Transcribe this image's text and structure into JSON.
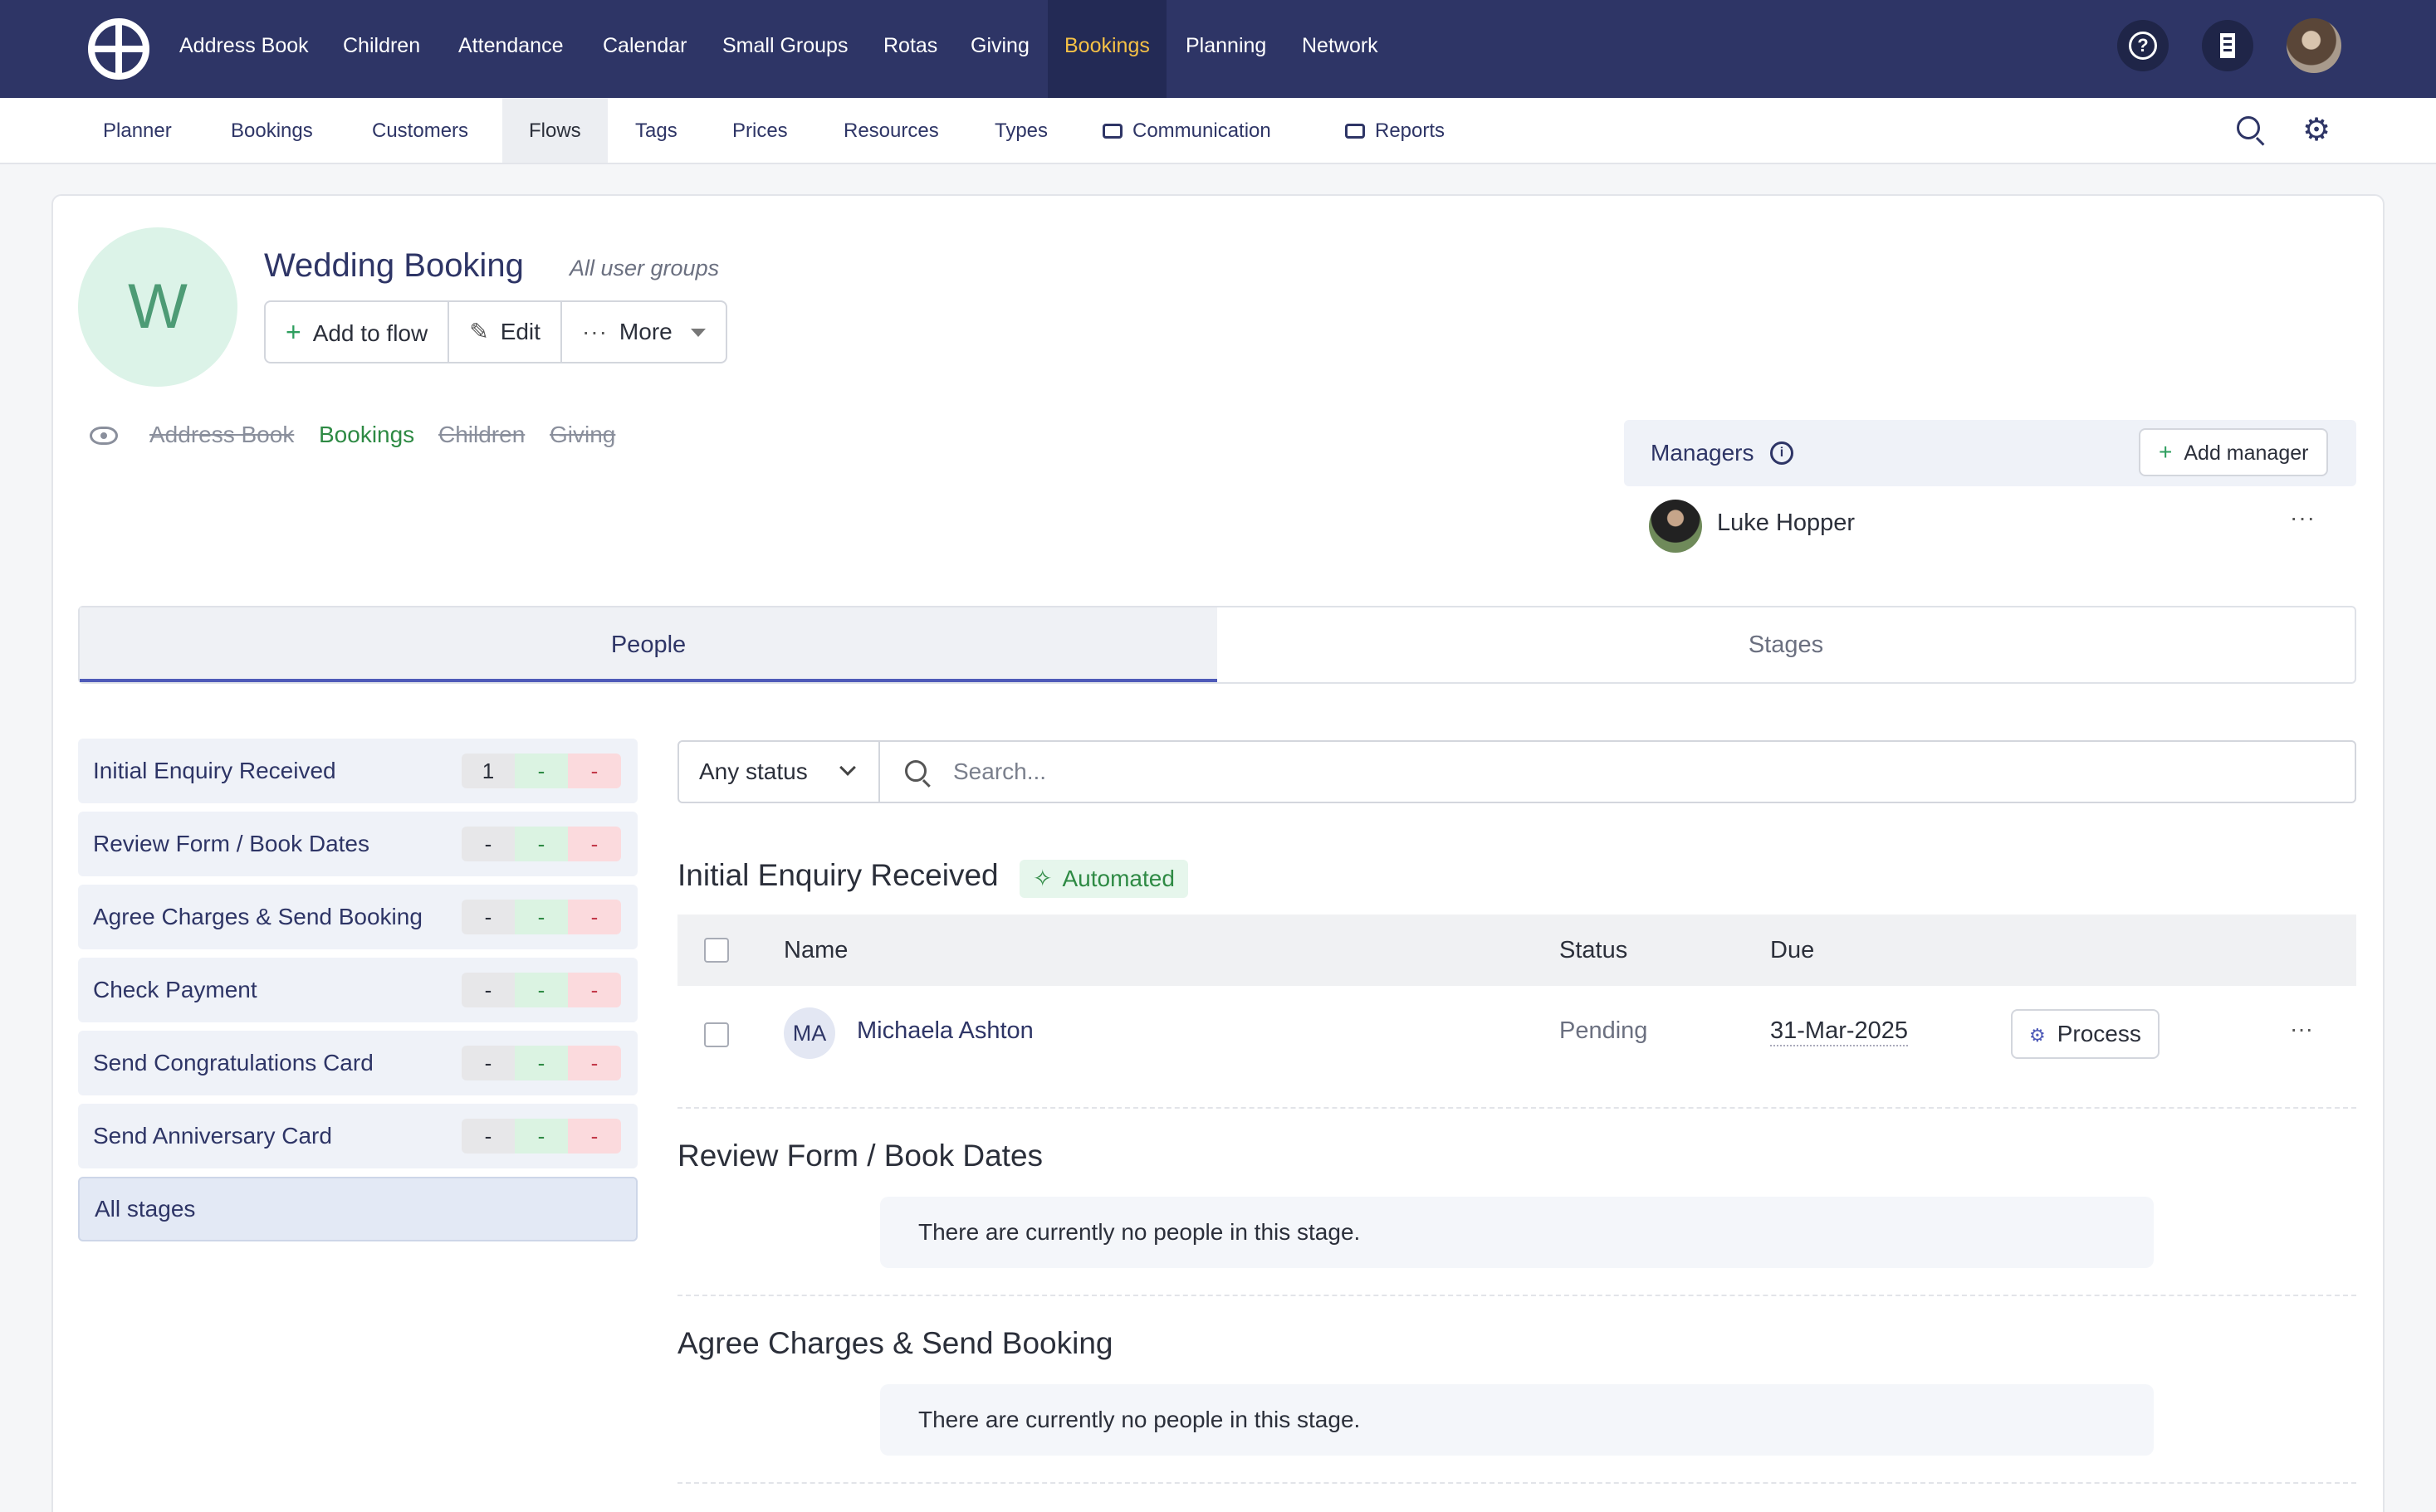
{
  "topnav": {
    "items": [
      "Address Book",
      "Children",
      "Attendance",
      "Calendar",
      "Small Groups",
      "Rotas",
      "Giving",
      "Bookings",
      "Planning",
      "Network"
    ],
    "active": "Bookings",
    "icons": [
      "help-icon",
      "building-icon",
      "user-avatar"
    ]
  },
  "subnav": {
    "items": [
      "Planner",
      "Bookings",
      "Customers",
      "Flows",
      "Tags",
      "Prices",
      "Resources",
      "Types",
      "Communication",
      "Reports"
    ],
    "active": "Flows",
    "icons": [
      "search-icon",
      "gear-icon"
    ]
  },
  "flow": {
    "initial": "W",
    "title": "Wedding Booking",
    "subtitle": "All user groups",
    "actions": {
      "add": "Add to flow",
      "edit": "Edit",
      "more": "More"
    },
    "visibility": [
      {
        "label": "Address Book",
        "enabled": false
      },
      {
        "label": "Bookings",
        "enabled": true
      },
      {
        "label": "Children",
        "enabled": false
      },
      {
        "label": "Giving",
        "enabled": false
      }
    ]
  },
  "managers": {
    "label": "Managers",
    "add_label": "Add manager",
    "list": [
      {
        "name": "Luke Hopper"
      }
    ]
  },
  "tabs": {
    "people": "People",
    "stages": "Stages",
    "active": "People"
  },
  "stages": [
    {
      "name": "Initial Enquiry Received",
      "counts": [
        "1",
        "-",
        "-"
      ]
    },
    {
      "name": "Review Form / Book Dates",
      "counts": [
        "-",
        "-",
        "-"
      ]
    },
    {
      "name": "Agree Charges & Send Booking",
      "counts": [
        "-",
        "-",
        "-"
      ]
    },
    {
      "name": "Check Payment",
      "counts": [
        "-",
        "-",
        "-"
      ]
    },
    {
      "name": "Send Congratulations Card",
      "counts": [
        "-",
        "-",
        "-"
      ]
    },
    {
      "name": "Send Anniversary Card",
      "counts": [
        "-",
        "-",
        "-"
      ]
    }
  ],
  "all_stages": "All stages",
  "filter": {
    "status": "Any status",
    "search_placeholder": "Search..."
  },
  "sections": [
    {
      "title": "Initial Enquiry Received",
      "badge": "Automated",
      "columns": [
        "Name",
        "Status",
        "Due"
      ],
      "rows": [
        {
          "initials": "MA",
          "name": "Michaela Ashton",
          "status": "Pending",
          "due": "31-Mar-2025",
          "action": "Process"
        }
      ]
    },
    {
      "title": "Review Form / Book Dates",
      "empty": "There are currently no people in this stage."
    },
    {
      "title": "Agree Charges & Send Booking",
      "empty": "There are currently no people in this stage."
    }
  ]
}
